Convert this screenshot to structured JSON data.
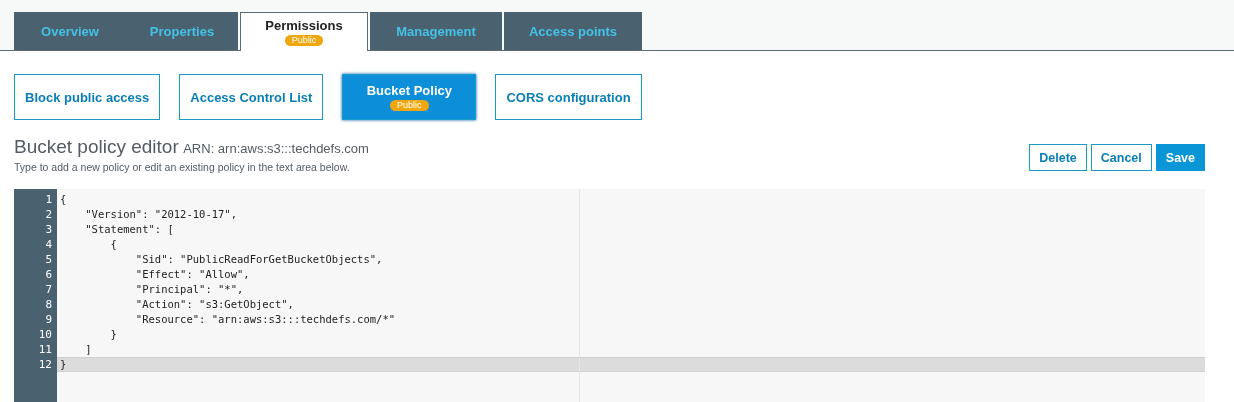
{
  "tabs": [
    {
      "label": "Overview",
      "selected": false
    },
    {
      "label": "Properties",
      "selected": false
    },
    {
      "label": "Permissions",
      "selected": true,
      "badge": "Public"
    },
    {
      "label": "Management",
      "selected": false
    },
    {
      "label": "Access points",
      "selected": false
    }
  ],
  "subtabs": [
    {
      "label": "Block public access",
      "selected": false
    },
    {
      "label": "Access Control List",
      "selected": false
    },
    {
      "label": "Bucket Policy",
      "selected": true,
      "badge": "Public"
    },
    {
      "label": "CORS configuration",
      "selected": false
    }
  ],
  "editor": {
    "title": "Bucket policy editor",
    "arn": "ARN: arn:aws:s3:::techdefs.com",
    "hint": "Type to add a new policy or edit an existing policy in the text area below.",
    "buttons": [
      {
        "label": "Delete",
        "kind": "secondary"
      },
      {
        "label": "Cancel",
        "kind": "secondary"
      },
      {
        "label": "Save",
        "kind": "primary"
      }
    ],
    "lines": [
      {
        "number": "1",
        "text": "{",
        "selected": false
      },
      {
        "number": "2",
        "text": "    \"Version\": \"2012-10-17\",",
        "selected": false
      },
      {
        "number": "3",
        "text": "    \"Statement\": [",
        "selected": false
      },
      {
        "number": "4",
        "text": "        {",
        "selected": false
      },
      {
        "number": "5",
        "text": "            \"Sid\": \"PublicReadForGetBucketObjects\",",
        "selected": false
      },
      {
        "number": "6",
        "text": "            \"Effect\": \"Allow\",",
        "selected": false
      },
      {
        "number": "7",
        "text": "            \"Principal\": \"*\",",
        "selected": false
      },
      {
        "number": "8",
        "text": "            \"Action\": \"s3:GetObject\",",
        "selected": false
      },
      {
        "number": "9",
        "text": "            \"Resource\": \"arn:aws:s3:::techdefs.com/*\"",
        "selected": false
      },
      {
        "number": "10",
        "text": "        }",
        "selected": false
      },
      {
        "number": "11",
        "text": "    ]",
        "selected": false
      },
      {
        "number": "12",
        "text": "}",
        "selected": true
      }
    ]
  }
}
